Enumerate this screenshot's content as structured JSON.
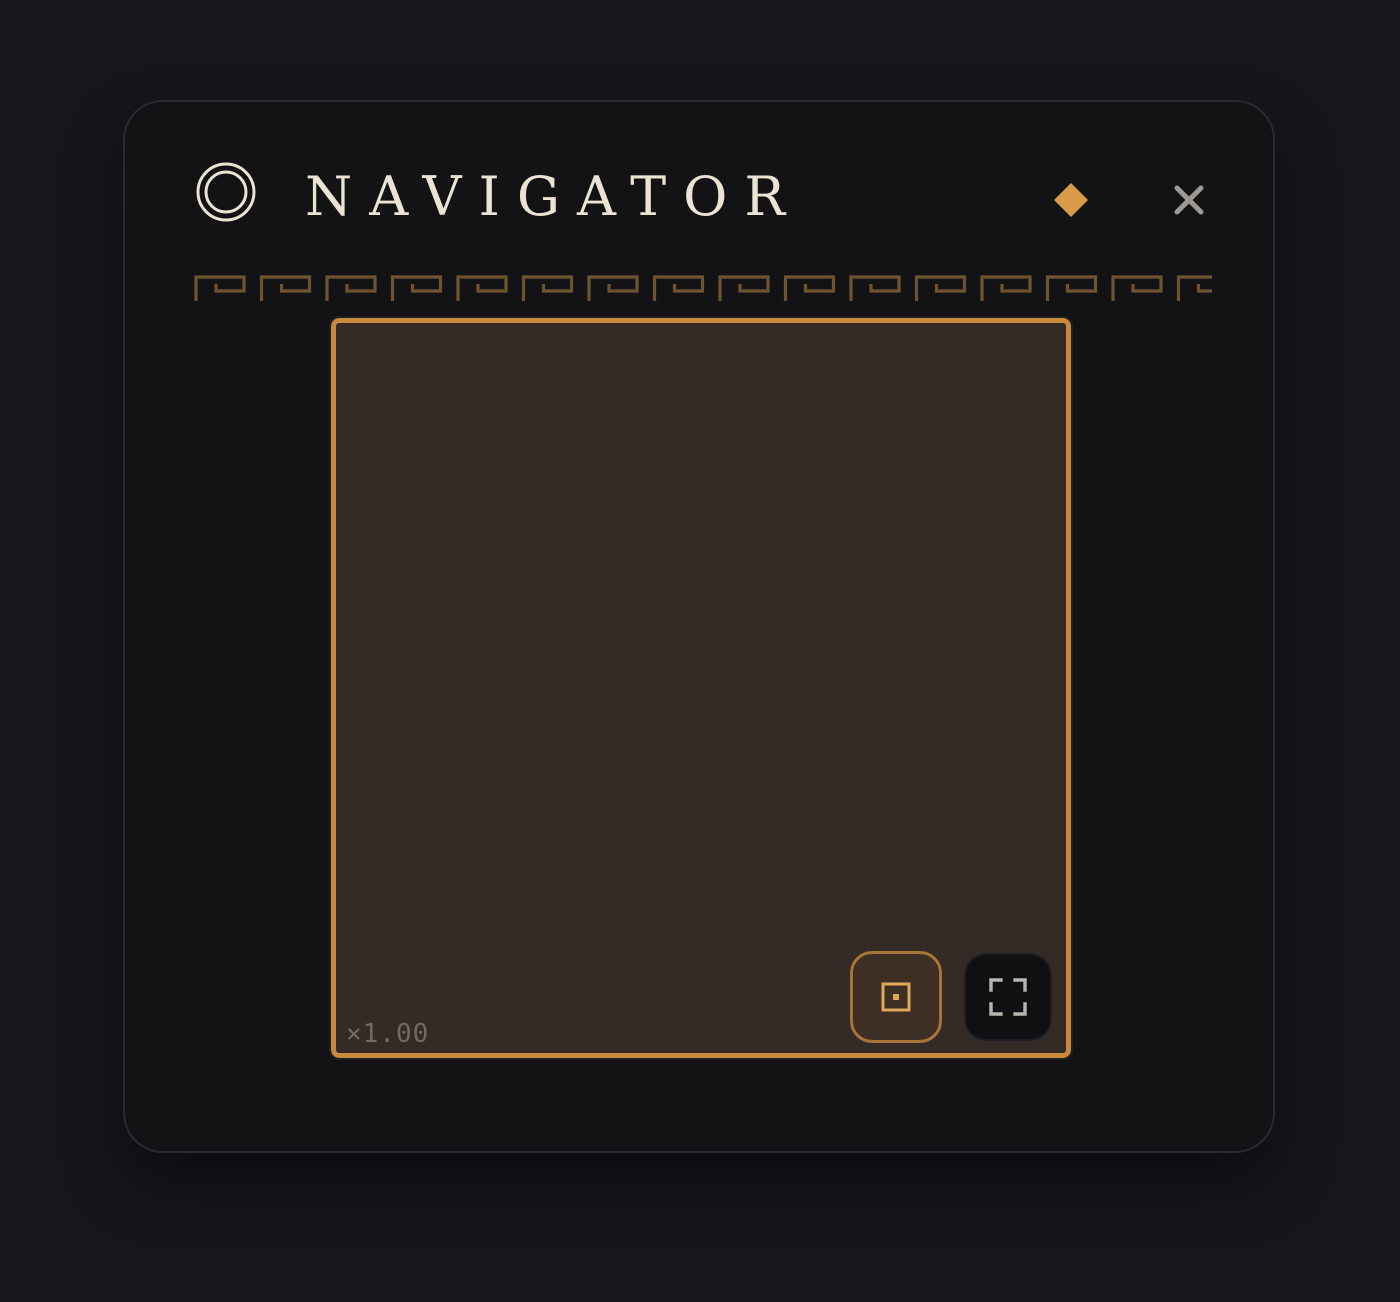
{
  "header": {
    "title": "NAVIGATOR",
    "icon": "concentric-circles-icon",
    "pin_icon": "diamond-icon",
    "close_icon": "close-icon"
  },
  "divider": {
    "pattern": "greek-key-meander"
  },
  "minimap": {
    "zoom_label": "×1.00",
    "buttons": [
      {
        "name": "center-view",
        "icon": "target-square-icon",
        "active": true
      },
      {
        "name": "fullscreen",
        "icon": "fullscreen-corners-icon",
        "active": false
      }
    ]
  },
  "colors": {
    "accent": "#d79a46",
    "title_text": "#ebe4d4",
    "panel_bg": "#131316",
    "minimap_bg": "#342b26",
    "minimap_border": "#c8893d",
    "meander": "#6e5330",
    "close_icon": "#9d9894"
  }
}
